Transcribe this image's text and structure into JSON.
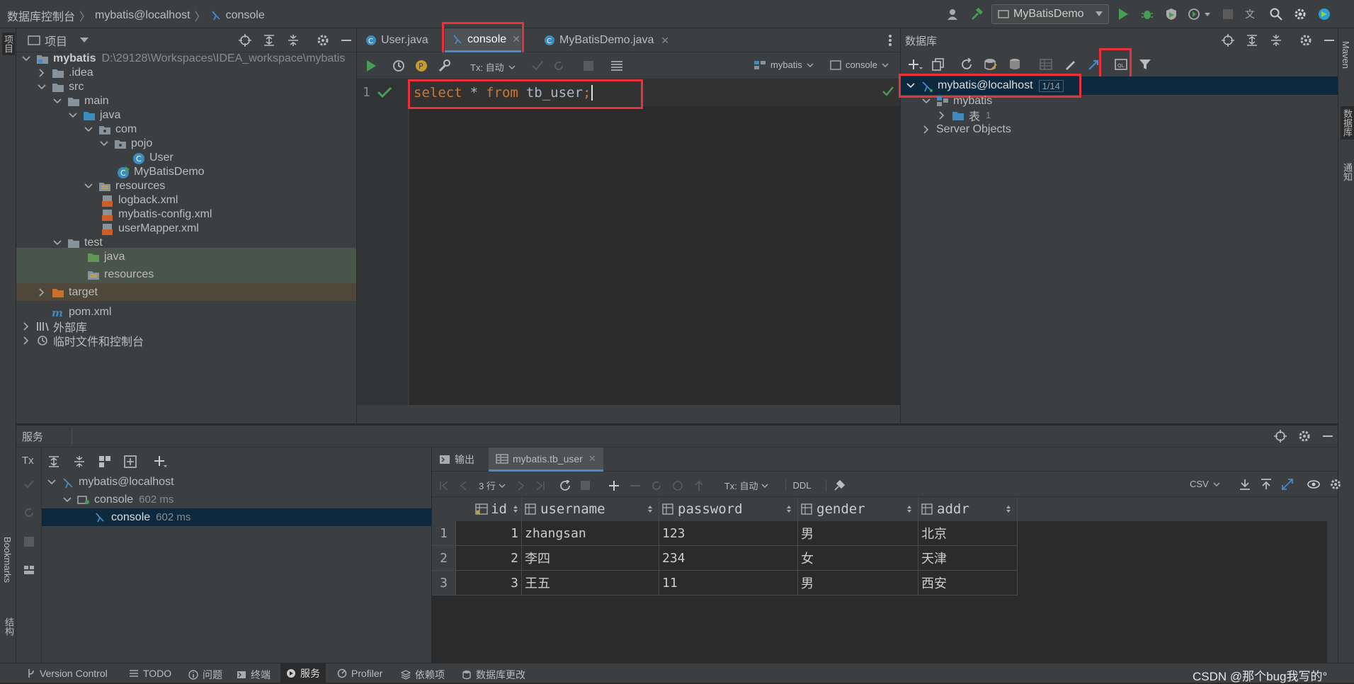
{
  "titlebar": {
    "crumbs": [
      "数据库控制台",
      "mybatis@localhost",
      "console"
    ],
    "run_config": "MyBatisDemo"
  },
  "project": {
    "header": "项目",
    "tree": [
      {
        "label": "mybatis",
        "extra": "D:\\29128\\Workspaces\\IDEA_workspace\\mybatis"
      },
      {
        "label": ".idea"
      },
      {
        "label": "src"
      },
      {
        "label": "main"
      },
      {
        "label": "java"
      },
      {
        "label": "com"
      },
      {
        "label": "pojo"
      },
      {
        "label": "User"
      },
      {
        "label": "MyBatisDemo"
      },
      {
        "label": "resources"
      },
      {
        "label": "logback.xml"
      },
      {
        "label": "mybatis-config.xml"
      },
      {
        "label": "userMapper.xml"
      },
      {
        "label": "test"
      },
      {
        "label": "java"
      },
      {
        "label": "resources"
      },
      {
        "label": "target"
      },
      {
        "label": "pom.xml"
      },
      {
        "label": "外部库"
      },
      {
        "label": "临时文件和控制台"
      }
    ]
  },
  "editor": {
    "tabs": [
      "User.java",
      "console",
      "MyBatisDemo.java"
    ],
    "tx_mode": "Tx: 自动",
    "schema": "mybatis",
    "session": "console",
    "line_number": "1",
    "code": {
      "kw1": "select",
      "star": "*",
      "kw2": "from",
      "ident": "tb_user",
      "semi": ";"
    }
  },
  "database": {
    "header": "数据库",
    "tree": [
      {
        "label": "mybatis@localhost",
        "badge": "1/14"
      },
      {
        "label": "mybatis"
      },
      {
        "label": "表",
        "count": "1"
      },
      {
        "label": "Server Objects"
      }
    ]
  },
  "right_strip": [
    "Maven",
    "数据库",
    "通知"
  ],
  "left_strip": [
    "项目",
    "Bookmarks",
    "结构"
  ],
  "services": {
    "header": "服务",
    "tree": [
      {
        "label": "mybatis@localhost"
      },
      {
        "label": "console",
        "time": "602 ms"
      },
      {
        "label": "console",
        "time": "602 ms"
      }
    ],
    "tabs": [
      "输出",
      "mybatis.tb_user"
    ],
    "rows_label": "3 行",
    "tx_mode": "Tx: 自动",
    "ddl": "DDL",
    "export_format": "CSV",
    "tx_label": "Tx"
  },
  "result": {
    "columns": [
      "id",
      "username",
      "password",
      "gender",
      "addr"
    ],
    "rows": [
      {
        "num": "1",
        "id": "1",
        "username": "zhangsan",
        "password": "123",
        "gender": "男",
        "addr": "北京"
      },
      {
        "num": "2",
        "id": "2",
        "username": "李四",
        "password": "234",
        "gender": "女",
        "addr": "天津"
      },
      {
        "num": "3",
        "id": "3",
        "username": "王五",
        "password": "11",
        "gender": "男",
        "addr": "西安"
      }
    ]
  },
  "statusbar": {
    "items": [
      "Version Control",
      "TODO",
      "问题",
      "终端",
      "服务",
      "Profiler",
      "依赖项",
      "数据库更改"
    ],
    "watermark": "CSDN @那个bug我写的°"
  },
  "colors": {
    "accent": "#4a88c7",
    "highlight_red": "#e8313a",
    "run_green": "#499c54",
    "selection": "#0d293e"
  }
}
